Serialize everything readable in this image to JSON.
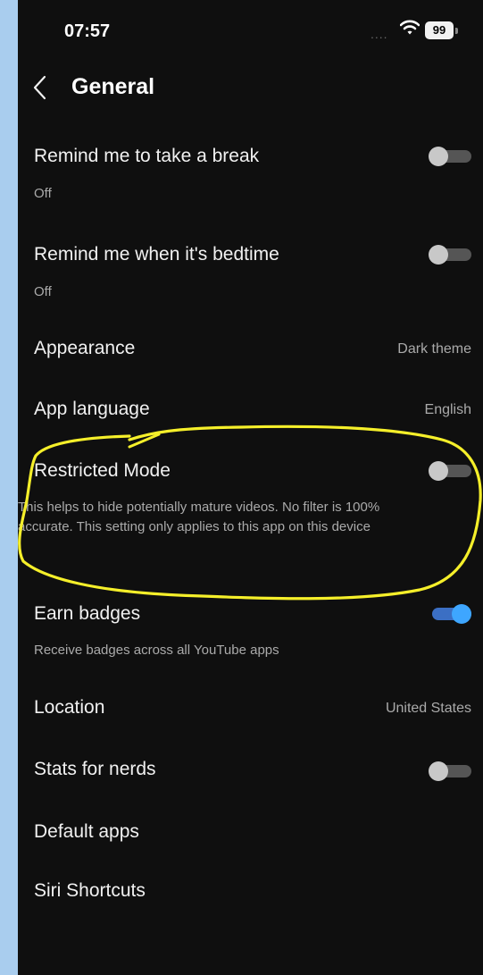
{
  "status_bar": {
    "time": "07:57",
    "signal": "....",
    "battery": "99"
  },
  "header": {
    "title": "General"
  },
  "settings": [
    {
      "label": "Remind me to take a break",
      "sub": "Off",
      "toggle": false
    },
    {
      "label": "Remind me when it's bedtime",
      "sub": "Off",
      "toggle": false
    },
    {
      "label": "Appearance",
      "value": "Dark theme"
    },
    {
      "label": "App language",
      "value": "English"
    },
    {
      "label": "Restricted Mode",
      "sub": "This helps to hide potentially mature videos. No filter is 100% accurate. This setting only applies to this app on this device",
      "toggle": false
    },
    {
      "label": "Earn badges",
      "sub": "Receive badges across all YouTube apps",
      "toggle": true
    },
    {
      "label": "Location",
      "value": "United States"
    },
    {
      "label": "Stats for nerds",
      "toggle": false
    },
    {
      "label": "Default apps"
    },
    {
      "label": "Siri Shortcuts"
    }
  ],
  "colors": {
    "background": "#0f0f0f",
    "toggle_on": "#3ea6ff",
    "annotation": "#f5ef2a",
    "outer": "#a9cdee"
  }
}
